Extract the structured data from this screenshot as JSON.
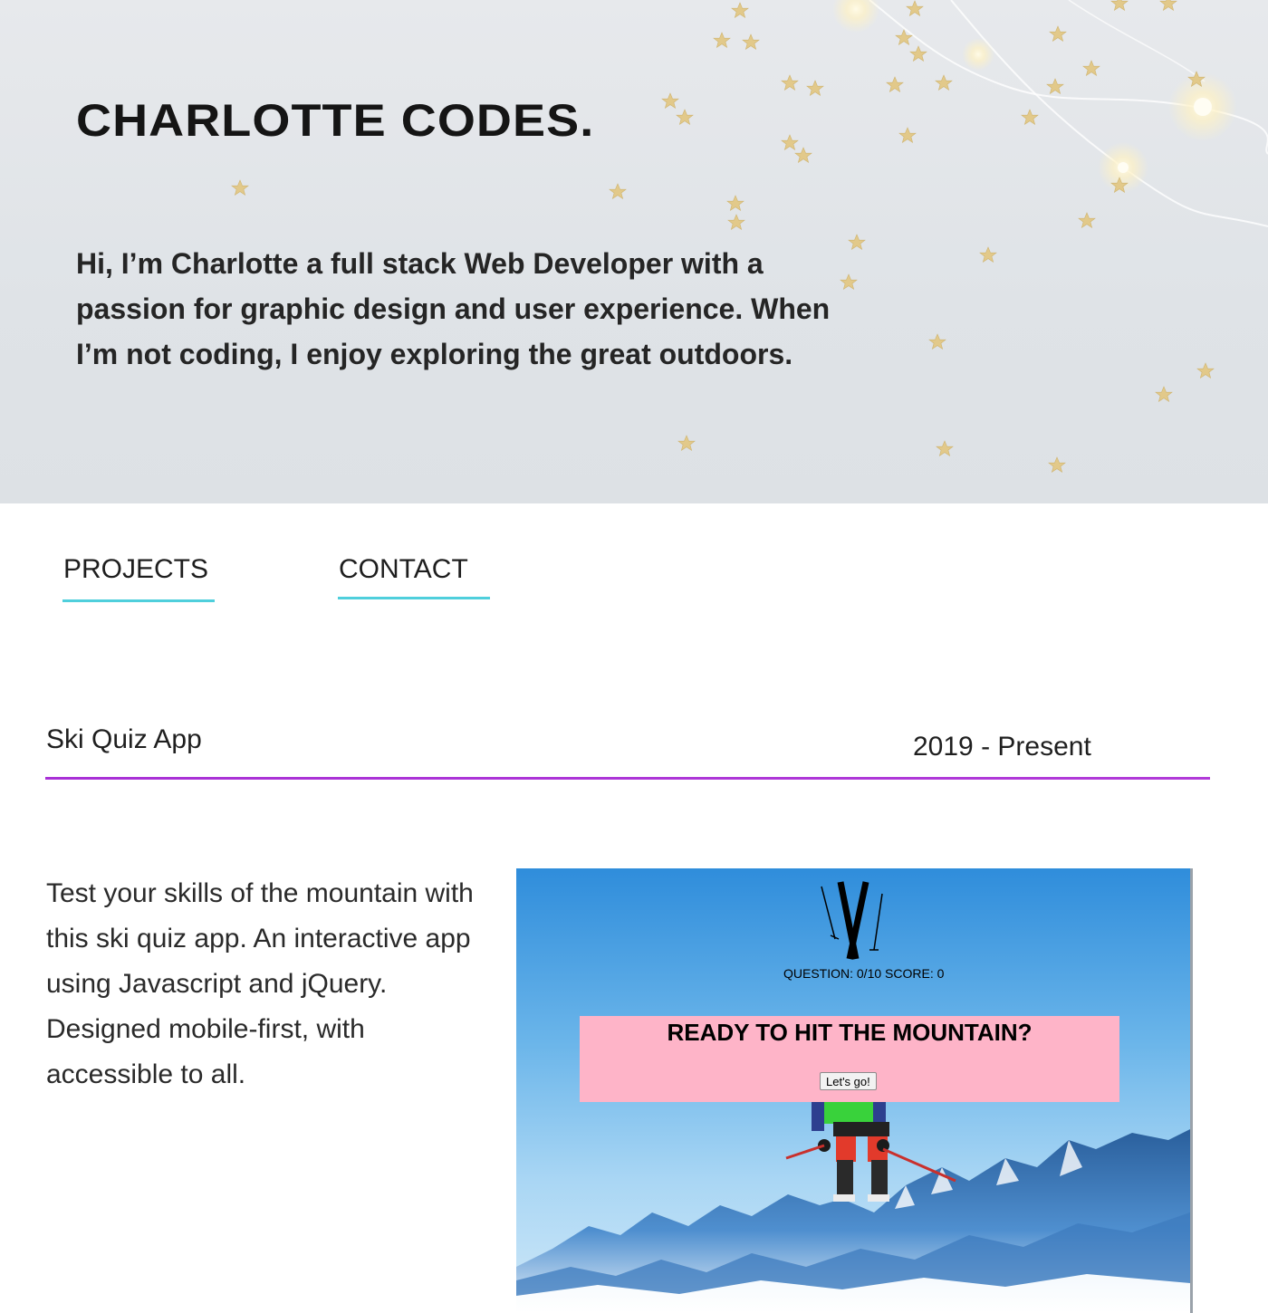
{
  "hero": {
    "title": "CHARLOTTE CODES.",
    "bio": "Hi, I’m Charlotte a full stack Web Developer with a passion for graphic design and user experience. When I’m not coding, I enjoy exploring the great outdoors."
  },
  "nav": {
    "projects": "PROJECTS",
    "contact": "CONTACT",
    "underline_color": "#4fcfdc"
  },
  "project": {
    "name": "Ski Quiz App",
    "dates": "2019 - Present",
    "description": "Test your skills of the mountain with this ski quiz app. An interactive app using Javascript and jQuery. Designed mobile-first, with accessible to all.",
    "divider_color": "#b13ad8",
    "screenshot": {
      "score_text": "QUESTION: 0/10 SCORE: 0",
      "heading": "READY TO HIT THE MOUNTAIN?",
      "button_label": "Let's go!",
      "panel_color": "#feb4c8"
    }
  }
}
